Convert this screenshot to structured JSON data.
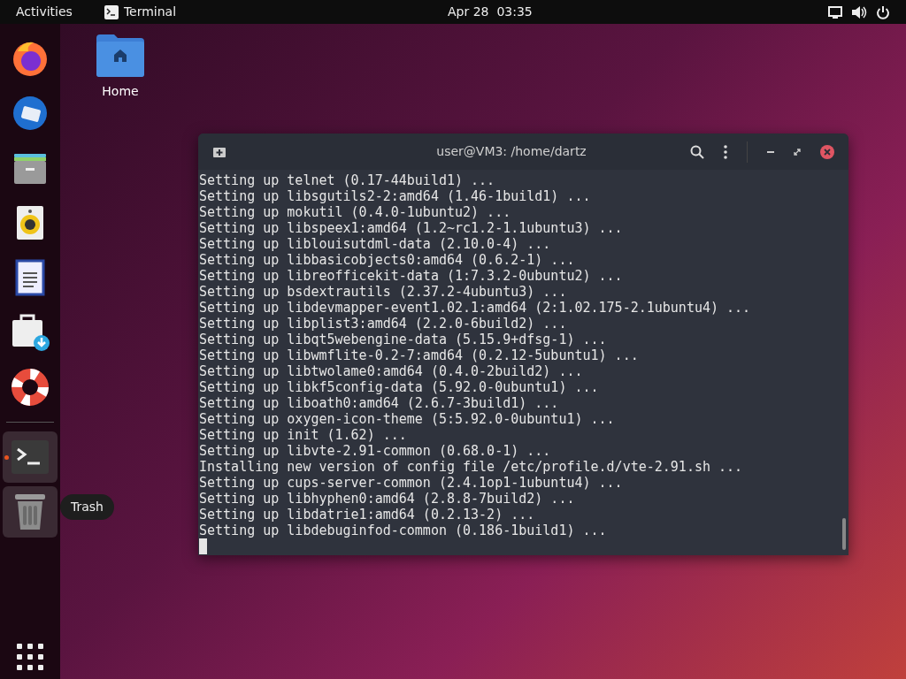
{
  "top_bar": {
    "activities": "Activities",
    "app_name": "Terminal",
    "clock": "Apr 28  03:35"
  },
  "dock": {
    "items": [
      {
        "kind": "browser",
        "running": false,
        "highlighted": false
      },
      {
        "kind": "mail",
        "running": false,
        "highlighted": false
      },
      {
        "kind": "files",
        "running": false,
        "highlighted": false
      },
      {
        "kind": "music",
        "running": false,
        "highlighted": false
      },
      {
        "kind": "writer",
        "running": false,
        "highlighted": false
      },
      {
        "kind": "software",
        "running": false,
        "highlighted": false
      },
      {
        "kind": "help",
        "running": false,
        "highlighted": false
      }
    ],
    "open_items": [
      {
        "kind": "terminal",
        "running": true,
        "highlighted": true
      },
      {
        "kind": "trash",
        "running": false,
        "highlighted": true
      }
    ],
    "tooltip": "Trash"
  },
  "desktop": {
    "icons": [
      {
        "label": "Home"
      }
    ]
  },
  "terminal": {
    "title": "user@VM3: /home/dartz",
    "lines": [
      "Setting up telnet (0.17-44build1) ...",
      "Setting up libsgutils2-2:amd64 (1.46-1build1) ...",
      "Setting up mokutil (0.4.0-1ubuntu2) ...",
      "Setting up libspeex1:amd64 (1.2~rc1.2-1.1ubuntu3) ...",
      "Setting up liblouisutdml-data (2.10.0-4) ...",
      "Setting up libbasicobjects0:amd64 (0.6.2-1) ...",
      "Setting up libreofficekit-data (1:7.3.2-0ubuntu2) ...",
      "Setting up bsdextrautils (2.37.2-4ubuntu3) ...",
      "Setting up libdevmapper-event1.02.1:amd64 (2:1.02.175-2.1ubuntu4) ...",
      "Setting up libplist3:amd64 (2.2.0-6build2) ...",
      "Setting up libqt5webengine-data (5.15.9+dfsg-1) ...",
      "Setting up libwmflite-0.2-7:amd64 (0.2.12-5ubuntu1) ...",
      "Setting up libtwolame0:amd64 (0.4.0-2build2) ...",
      "Setting up libkf5config-data (5.92.0-0ubuntu1) ...",
      "Setting up liboath0:amd64 (2.6.7-3build1) ...",
      "Setting up oxygen-icon-theme (5:5.92.0-0ubuntu1) ...",
      "Setting up init (1.62) ...",
      "Setting up libvte-2.91-common (0.68.0-1) ...",
      "Installing new version of config file /etc/profile.d/vte-2.91.sh ...",
      "Setting up cups-server-common (2.4.1op1-1ubuntu4) ...",
      "Setting up libhyphen0:amd64 (2.8.8-7build2) ...",
      "Setting up libdatrie1:amd64 (0.2.13-2) ...",
      "Setting up libdebuginfod-common (0.186-1build1) ..."
    ]
  }
}
